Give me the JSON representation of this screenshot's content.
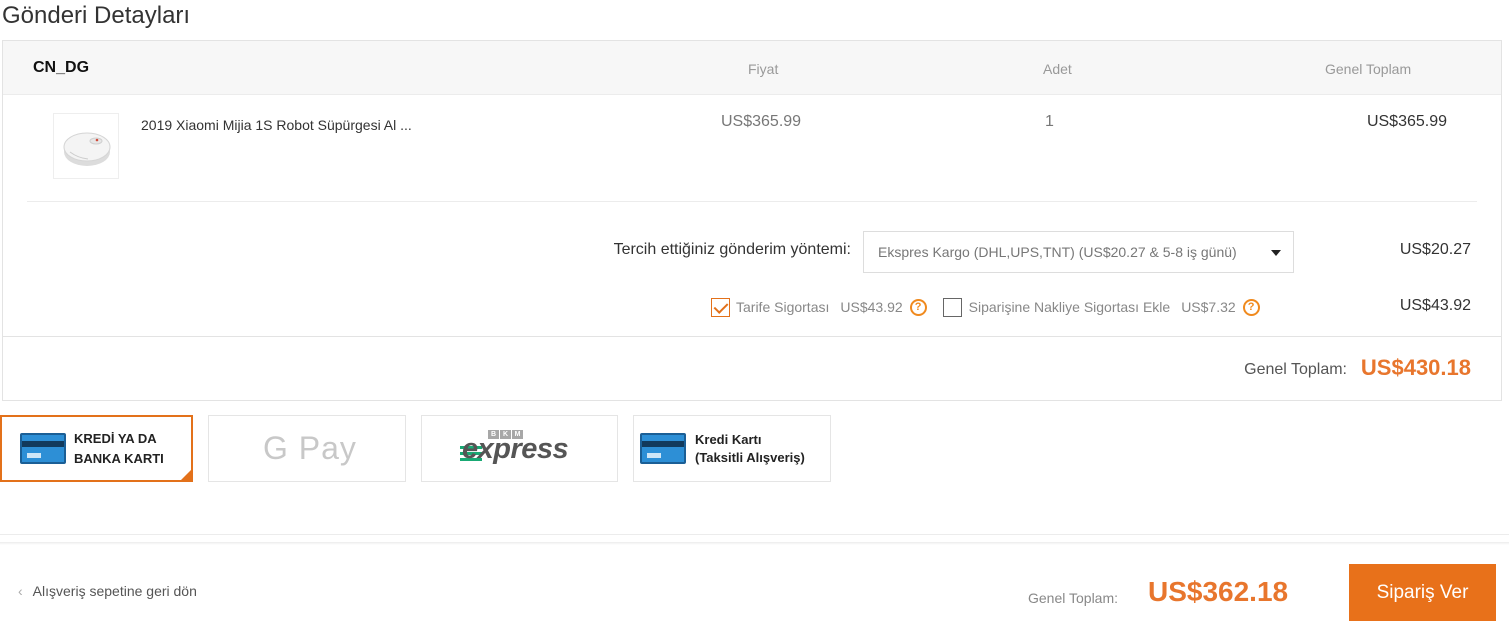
{
  "page": {
    "title": "Gönderi Detayları"
  },
  "order": {
    "seller": "CN_DG",
    "columns": {
      "price": "Fiyat",
      "quantity": "Adet",
      "total": "Genel Toplam"
    },
    "item": {
      "title": "2019 Xiaomi Mijia 1S Robot Süpürgesi Al ...",
      "price": "US$365.99",
      "quantity": "1",
      "total": "US$365.99",
      "thumbnail_icon": "robot-vacuum-icon"
    },
    "shipping": {
      "label": "Tercih ettiğiniz gönderim yöntemi:",
      "selected": "Ekspres Kargo (DHL,UPS,TNT) (US$20.27 & 5-8 iş günü)",
      "cost": "US$20.27"
    },
    "insurance": {
      "tariff_label": "Tarife Sigortası",
      "tariff_price": "US$43.92",
      "tariff_checked": true,
      "shipping_ins_label": "Siparişine Nakliye Sigortası Ekle",
      "shipping_ins_price": "US$7.32",
      "shipping_ins_checked": false,
      "cost": "US$43.92"
    },
    "grand_total_label": "Genel Toplam:",
    "grand_total_value": "US$430.18"
  },
  "payment_methods": [
    {
      "id": "credit-card",
      "line1": "KREDİ YA DA",
      "line2": "BANKA KARTI",
      "selected": true
    },
    {
      "id": "gpay",
      "label": "G Pay",
      "selected": false
    },
    {
      "id": "bkm",
      "brand_letters": [
        "B",
        "K",
        "M"
      ],
      "label": "express",
      "selected": false
    },
    {
      "id": "installment",
      "line1": "Kredi Kartı",
      "line2": "(Taksitli Alışveriş)",
      "selected": false
    }
  ],
  "footer": {
    "back_label": "Alışveriş sepetine geri dön",
    "total_label": "Genel Toplam:",
    "total_value": "US$362.18",
    "order_button": "Sipariş Ver"
  },
  "colors": {
    "accent": "#e8711a",
    "price_orange": "#e8762d",
    "bkm_green": "#19a974"
  }
}
